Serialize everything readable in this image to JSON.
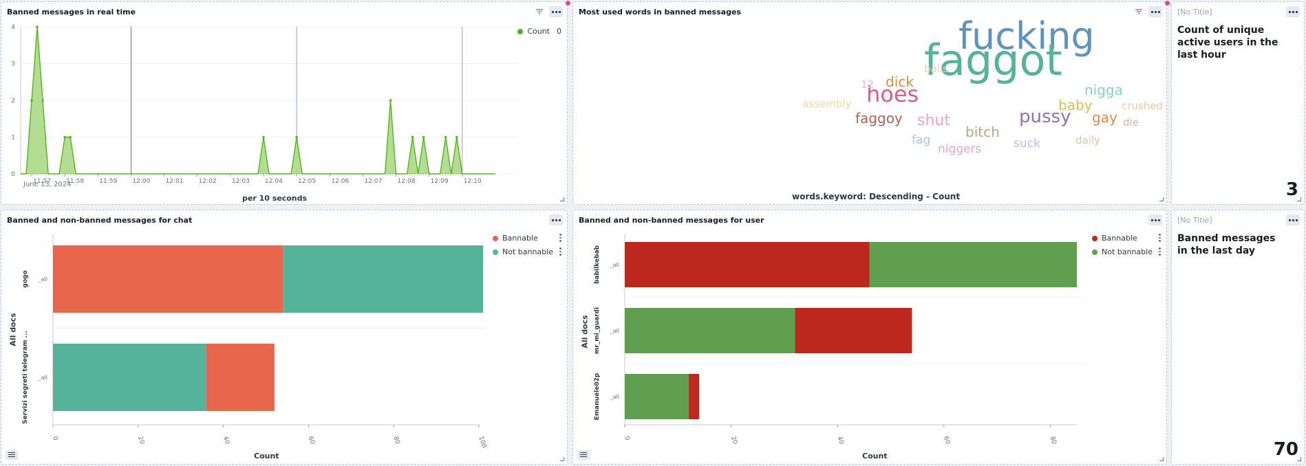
{
  "panels": {
    "realtime": {
      "title": "Banned messages in real time",
      "legend_label": "Count",
      "legend_value": "0",
      "x_axis_title": "per 10 seconds",
      "date_label": "June 13, 2024"
    },
    "words": {
      "title": "Most used words in banned messages",
      "axis_title": "words.keyword: Descending - Count",
      "cloud": [
        {
          "word": "fucking",
          "color": "#6092c0"
        },
        {
          "word": "faggot",
          "color": "#54b399"
        },
        {
          "word": "hoes",
          "color": "#d36086"
        },
        {
          "word": "pussy",
          "color": "#9170b8"
        },
        {
          "word": "nigga",
          "color": "#8bd0c0"
        },
        {
          "word": "baby",
          "color": "#d6bf57"
        },
        {
          "word": "gay",
          "color": "#da8b45"
        },
        {
          "word": "dick",
          "color": "#da8b45"
        },
        {
          "word": "faggoy",
          "color": "#aa6556"
        },
        {
          "word": "shut",
          "color": "#e7a5c4"
        },
        {
          "word": "bitch",
          "color": "#b9a888"
        },
        {
          "word": "balls",
          "color": "#e4d5b5"
        },
        {
          "word": "12",
          "color": "#efb6cc"
        },
        {
          "word": "assembly",
          "color": "#f1d9a3"
        },
        {
          "word": "crushed",
          "color": "#f2c8a5"
        },
        {
          "word": "die",
          "color": "#e7b1a4"
        },
        {
          "word": "fag",
          "color": "#a5c8e4"
        },
        {
          "word": "niggers",
          "color": "#e7a5c4"
        },
        {
          "word": "suck",
          "color": "#c8b8e0"
        },
        {
          "word": "daily",
          "color": "#d4c6a0"
        }
      ]
    },
    "unique_users": {
      "no_title": "[No Title]",
      "label": "Count of unique active users in the last hour",
      "value": "3"
    },
    "chat": {
      "title": "Banned and non-banned messages for chat",
      "y_axis_title": "All docs",
      "x_axis_title": "Count",
      "legend": [
        {
          "name": "Bannable",
          "color": "#e7664c"
        },
        {
          "name": "Not bannable",
          "color": "#54b399"
        }
      ]
    },
    "user": {
      "title": "Banned and non-banned messages for user",
      "y_axis_title": "All docs",
      "x_axis_title": "Count",
      "legend": [
        {
          "name": "Bannable",
          "color": "#bd271e"
        },
        {
          "name": "Not bannable",
          "color": "#609f50"
        }
      ]
    },
    "banned_day": {
      "no_title": "[No Title]",
      "label": "Banned messages in the last day",
      "value": "70"
    }
  },
  "chart_data": [
    {
      "type": "area",
      "title": "Banned messages in real time",
      "xlabel": "per 10 seconds",
      "ylabel": "",
      "ylim": [
        0,
        4
      ],
      "x_ticks": [
        "11:57",
        "11:58",
        "11:59",
        "12:00",
        "12:01",
        "12:02",
        "12:03",
        "12:04",
        "12:05",
        "12:06",
        "12:07",
        "12:08",
        "12:09",
        "12:10"
      ],
      "series": [
        {
          "name": "Count",
          "color": "#7ec65a",
          "points": [
            [
              "11:56:50",
              0
            ],
            [
              "11:57:00",
              2
            ],
            [
              "11:57:10",
              4
            ],
            [
              "11:57:20",
              2
            ],
            [
              "11:57:30",
              0
            ],
            [
              "11:57:50",
              0
            ],
            [
              "11:58:00",
              1
            ],
            [
              "11:58:10",
              1
            ],
            [
              "11:58:20",
              0
            ],
            [
              "12:03:50",
              0
            ],
            [
              "12:04:00",
              1
            ],
            [
              "12:04:10",
              0
            ],
            [
              "12:04:50",
              0
            ],
            [
              "12:05:00",
              1
            ],
            [
              "12:05:10",
              0
            ],
            [
              "12:07:40",
              0
            ],
            [
              "12:07:50",
              2
            ],
            [
              "12:08:00",
              0
            ],
            [
              "12:08:20",
              0
            ],
            [
              "12:08:30",
              1
            ],
            [
              "12:08:40",
              0
            ],
            [
              "12:08:40",
              0
            ],
            [
              "12:08:50",
              1
            ],
            [
              "12:09:00",
              0
            ],
            [
              "12:09:20",
              0
            ],
            [
              "12:09:30",
              1
            ],
            [
              "12:09:40",
              0
            ],
            [
              "12:09:40",
              0
            ],
            [
              "12:09:50",
              1
            ],
            [
              "12:10:00",
              0
            ]
          ]
        }
      ]
    },
    {
      "type": "bar",
      "orientation": "horizontal",
      "stacked": true,
      "title": "Banned and non-banned messages for chat",
      "xlabel": "Count",
      "ylabel": "All docs",
      "xlim": [
        0,
        100
      ],
      "x_ticks": [
        0,
        20,
        40,
        60,
        80,
        100
      ],
      "categories": [
        "gogo",
        "Servizi segreti telegram ..."
      ],
      "sub_label": "_all",
      "rows": [
        {
          "category": "gogo",
          "segments": [
            {
              "name": "Bannable",
              "value": 54
            },
            {
              "name": "Not bannable",
              "value": 47
            }
          ]
        },
        {
          "category": "Servizi segreti telegram ...",
          "segments": [
            {
              "name": "Not bannable",
              "value": 36
            },
            {
              "name": "Bannable",
              "value": 16
            }
          ]
        }
      ]
    },
    {
      "type": "bar",
      "orientation": "horizontal",
      "stacked": true,
      "title": "Banned and non-banned messages for user",
      "xlabel": "Count",
      "ylabel": "All docs",
      "xlim": [
        0,
        85
      ],
      "x_ticks": [
        0,
        20,
        40,
        60,
        80
      ],
      "categories": [
        "babilkebab",
        "mr_mi_guardi",
        "Emanuele02p"
      ],
      "sub_label": "_all",
      "rows": [
        {
          "category": "babilkebab",
          "segments": [
            {
              "name": "Bannable",
              "value": 46
            },
            {
              "name": "Not bannable",
              "value": 39
            }
          ]
        },
        {
          "category": "mr_mi_guardi",
          "segments": [
            {
              "name": "Not bannable",
              "value": 32
            },
            {
              "name": "Bannable",
              "value": 22
            }
          ]
        },
        {
          "category": "Emanuele02p",
          "segments": [
            {
              "name": "Not bannable",
              "value": 12
            },
            {
              "name": "Bannable",
              "value": 2
            }
          ]
        }
      ]
    }
  ]
}
